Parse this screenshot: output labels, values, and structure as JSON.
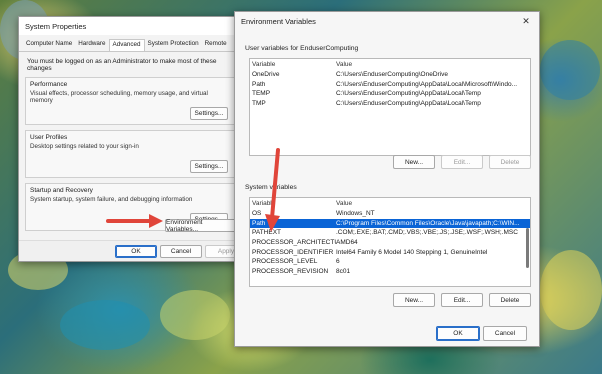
{
  "system_properties": {
    "title": "System Properties",
    "tabs": [
      "Computer Name",
      "Hardware",
      "Advanced",
      "System Protection",
      "Remote"
    ],
    "admin_note": "You must be logged on as an Administrator to make most of these changes",
    "performance": {
      "title": "Performance",
      "desc": "Visual effects, processor scheduling, memory usage, and virtual memory",
      "button": "Settings..."
    },
    "user_profiles": {
      "title": "User Profiles",
      "desc": "Desktop settings related to your sign-in",
      "button": "Settings..."
    },
    "startup": {
      "title": "Startup and Recovery",
      "desc": "System startup, system failure, and debugging information",
      "button": "Settings..."
    },
    "env_button": "Environment Variables...",
    "ok": "OK",
    "cancel": "Cancel",
    "apply": "Apply"
  },
  "env_vars": {
    "title": "Environment Variables",
    "user_section": "User variables for EnduserComputing",
    "col_variable": "Variable",
    "col_value": "Value",
    "user_rows": [
      {
        "variable": "OneDrive",
        "value": "C:\\Users\\EnduserComputing\\OneDrive"
      },
      {
        "variable": "Path",
        "value": "C:\\Users\\EnduserComputing\\AppData\\Local\\Microsoft\\Windo..."
      },
      {
        "variable": "TEMP",
        "value": "C:\\Users\\EnduserComputing\\AppData\\Local\\Temp"
      },
      {
        "variable": "TMP",
        "value": "C:\\Users\\EnduserComputing\\AppData\\Local\\Temp"
      }
    ],
    "user_buttons": {
      "new": "New...",
      "edit": "Edit...",
      "delete": "Delete"
    },
    "system_section": "System variables",
    "system_rows": [
      {
        "variable": "OS",
        "value": "Windows_NT"
      },
      {
        "variable": "Path",
        "value": "C:\\Program Files\\Common Files\\Oracle\\Java\\javapath;C:\\WIN..."
      },
      {
        "variable": "PATHEXT",
        "value": ".COM;.EXE;.BAT;.CMD;.VBS;.VBE;.JS;.JSE;.WSF;.WSH;.MSC"
      },
      {
        "variable": "PROCESSOR_ARCHITECTU...",
        "value": "AMD64"
      },
      {
        "variable": "PROCESSOR_IDENTIFIER",
        "value": "Intel64 Family 6 Model 140 Stepping 1, GenuineIntel"
      },
      {
        "variable": "PROCESSOR_LEVEL",
        "value": "6"
      },
      {
        "variable": "PROCESSOR_REVISION",
        "value": "8c01"
      }
    ],
    "system_buttons": {
      "new": "New...",
      "edit": "Edit...",
      "delete": "Delete"
    },
    "ok": "OK",
    "cancel": "Cancel"
  }
}
